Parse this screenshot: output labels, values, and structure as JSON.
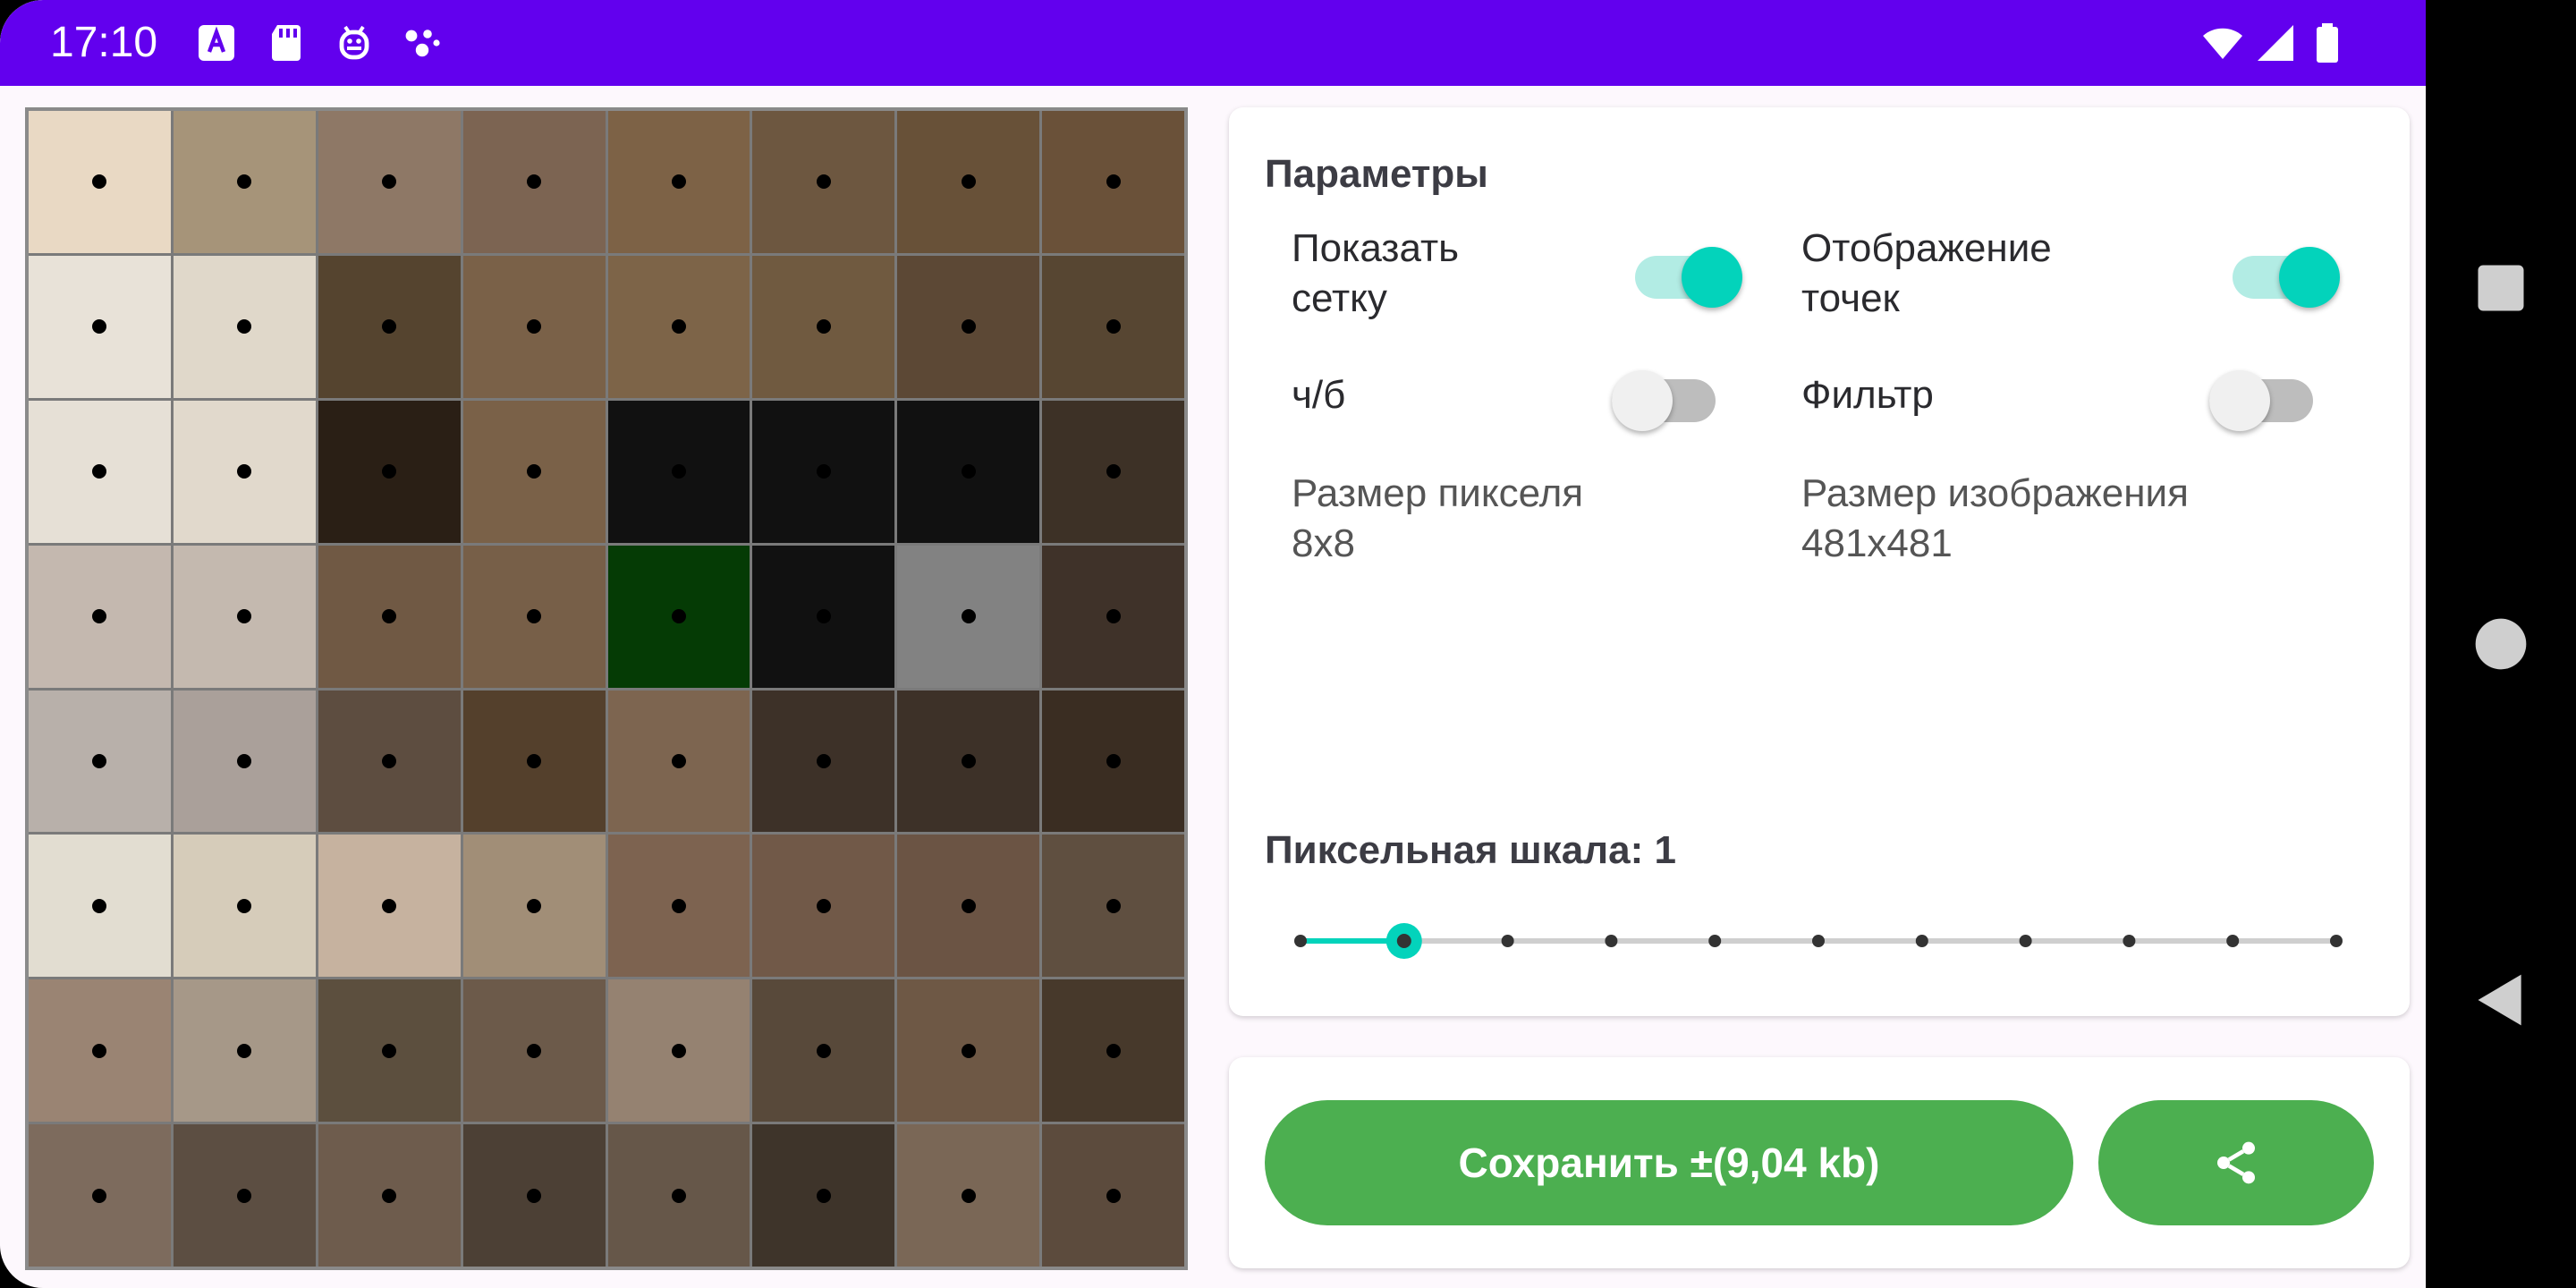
{
  "status_bar": {
    "time": "17:10",
    "color": "#6200ee",
    "left_icons": [
      "font-download-icon",
      "sd-card-icon",
      "android-debug-icon",
      "assistant-dots-icon"
    ],
    "right_icons": [
      "wifi-icon",
      "signal-icon",
      "battery-icon"
    ]
  },
  "pixel_grid": {
    "rows": 8,
    "cols": 8,
    "show_dots": true,
    "colors": [
      [
        "#e9d9c4",
        "#a69479",
        "#8e7866",
        "#7c6452",
        "#7d6246",
        "#6d5740",
        "#685138",
        "#6a5139"
      ],
      [
        "#e8e2d8",
        "#e0d8ca",
        "#55442f",
        "#7a6148",
        "#7d6448",
        "#705a40",
        "#5c4835",
        "#574632"
      ],
      [
        "#e6e0d6",
        "#e1d9cc",
        "#2a1f15",
        "#7a6148",
        "#111111",
        "#111111",
        "#111111",
        "#3d3126"
      ],
      [
        "#c4b8af",
        "#c4b9af",
        "#705944",
        "#775f48",
        "#053b05",
        "#111111",
        "#828282",
        "#3f3229"
      ],
      [
        "#b8b0aa",
        "#aaa09a",
        "#5d4d40",
        "#54402c",
        "#7d6550",
        "#3d3128",
        "#3d3128",
        "#3a2d22"
      ],
      [
        "#e2ddd1",
        "#d6ccba",
        "#c6b29f",
        "#a18e77",
        "#7d6350",
        "#715948",
        "#6b5444",
        "#5f4f40"
      ],
      [
        "#9a8473",
        "#a69888",
        "#5c4f3e",
        "#6c5a4a",
        "#958271",
        "#58493a",
        "#6e5845",
        "#47392b"
      ],
      [
        "#7d6b5d",
        "#5c4e42",
        "#6e5c4d",
        "#4c4035",
        "#665749",
        "#3e342a",
        "#7a6756",
        "#5c4b3d"
      ]
    ]
  },
  "params": {
    "title": "Параметры",
    "show_grid_label_line1": "Показать",
    "show_grid_label_line2": "сетку",
    "show_grid_on": true,
    "show_dots_label_line1": "Отображение",
    "show_dots_label_line2": "точек",
    "show_dots_on": true,
    "bw_label": "ч/б",
    "bw_on": false,
    "filter_label": "Фильтр",
    "filter_on": false,
    "pixel_size_label": "Размер пикселя",
    "pixel_size_value": "8x8",
    "image_size_label": "Размер изображения",
    "image_size_value": "481x481",
    "accent_color": "#03d3bb"
  },
  "scale": {
    "label": "Пиксельная шкала: 1",
    "steps": 11,
    "selected_index": 1
  },
  "actions": {
    "save_label": "Сохранить ±(9,04 kb)",
    "share_icon": "share-icon",
    "button_color": "#4caf50"
  },
  "nav_bar": {
    "items": [
      "recents-square-icon",
      "home-circle-icon",
      "back-triangle-icon"
    ]
  }
}
